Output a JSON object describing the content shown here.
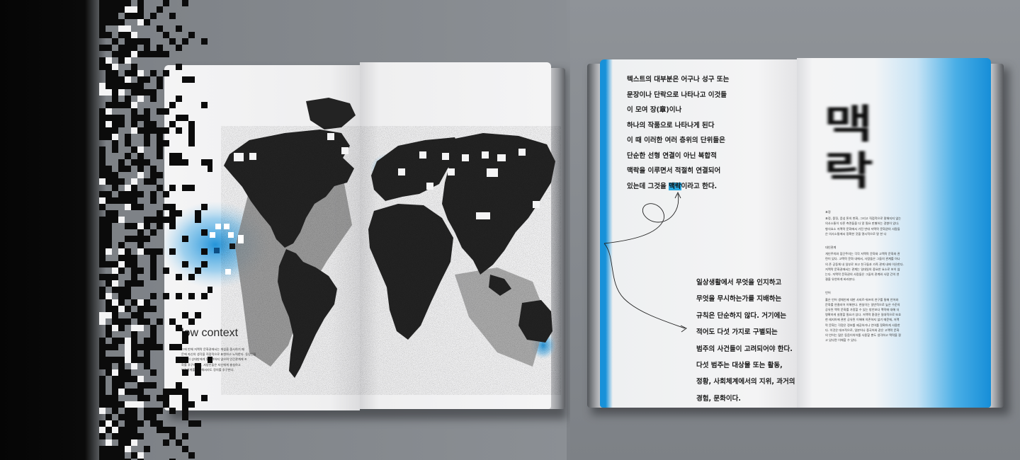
{
  "left_spread": {
    "heading": "low context",
    "body_lines": [
      "그에 반해 저맥락 문화권에서는 개성을 중시하기 때",
      "문에 자신의 생각을 직접적으로 표현하고 노력한다. 동양인들",
      "은 미리 상대방에게 맞추려하지 않으며 인간관계에 조",
      "화를 추구하지만, 서양인들은 자신에게 충실하고",
      "인간관계를 희생해서라도 정의를 추구한다."
    ]
  },
  "right_spread": {
    "top_text": [
      "텍스트의 대부분은 어구나 성구 또는",
      "문장이나 단락으로 나타나고 이것들",
      "이 모여 장(章)이나",
      "하나의 작품으로 나타나게 된다",
      "이 때 이러한 여러 층위의 단위들은",
      "단순한 선형 연결이 아닌 복합적",
      "맥락을 이루면서 적절히 연결되어"
    ],
    "top_last_before": "있는데 그것을 ",
    "top_last_highlight": "맥락",
    "top_last_after": "이라고 한다.",
    "bottom_text": [
      "일상생활에서 무엇을 인지하고",
      "무엇을 무시하는가를 지배하는",
      "규칙은 단순하지 않다. 거기에는",
      "적어도 다섯 가지로 구별되는",
      "범주의 사건들이 고려되어야 한다.",
      "다섯 범주는 대상물 또는 활동,",
      "정황, 사회체계에서의 지위, 과거의",
      "경험, 문화이다."
    ],
    "title_chars": [
      "맥",
      "락"
    ],
    "sections": [
      {
        "heading": "표정",
        "lines": [
          "표정, 몸짓, 음성 톤의 변화, 그리고 직접적으로 말해지지 않는",
          "의사소통이 다른 측면들을 다 알 필요 판별하는 경향이 있다.",
          "형식요소 저맥락 문화에서 가진 반대 저맥락 문화권의 사람들",
          "은 의사소통에서 정확한 것을 명시적으로 말 한 다"
        ]
      },
      {
        "heading": "대인관계",
        "lines": [
          "개인주의와 집단주의는 각각 저맥락 문화와 고맥락 문화와 관",
          "련이 있다. 고맥락 문화 내에서, 사람들은 그들의 관계를 아나",
          "의 존 공동체 내 일부로 보고 친구들과 가족 관계 내에 이은한다.",
          "저맥락 문화권에서는 관계는 일대일의 중요한 요소로 보이 않",
          "는다. 저맥락 문화권의 사람들은 그들의 관계와 사람 간의 연",
          "결을 유연하게 바라본다."
        ]
      },
      {
        "heading": "언어",
        "lines": [
          "홀은 언어 생체인에 대한 사피르-워프의 연구를 통해 언어와",
          "문화를 연결지어 이해한다. 현실이는 일반적으로 높은 수준의",
          "공유된 맥락 문화를 가정할 수 있는 방언보다 맥락에 대해 더",
          "명확하게 설명할 필요가 있다. 저맥락 환경은 일대적으로 또호",
          "한 레지아에 관한 공유된 이해에 의존하지 않기 때문에, 저맥",
          "락 문화는 각정은 정보를 제공하거나 언어를 정확하게 사용한",
          "다. 이것은 대조적으로, 일본어나 중국어와 같은 고맥락 문화",
          "의 언어는 많은 동음이의어를 사용할 뿐도 생각하고 맥락을 잘",
          "고 있다면 이해할 수 있다."
        ]
      }
    ]
  },
  "colors": {
    "accent": "#1a8fd8",
    "map_land": "#232323",
    "map_grey": "#8c8c8c",
    "page": "#f2f2f3",
    "background": "#85898e"
  }
}
